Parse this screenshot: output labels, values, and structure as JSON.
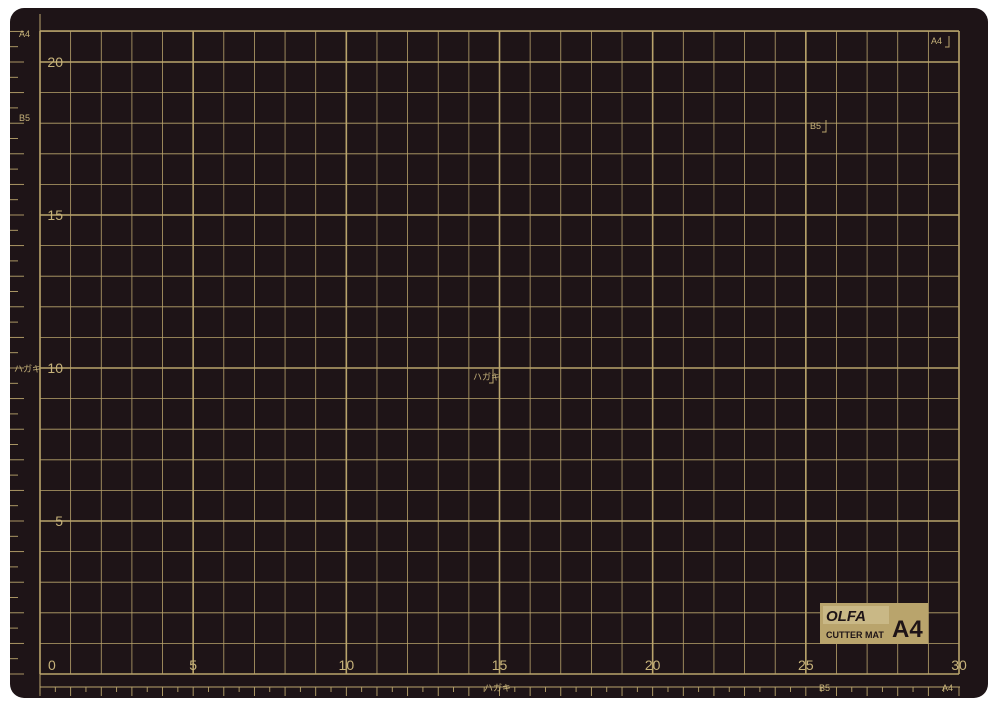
{
  "mat": {
    "background_color": "#1e1417",
    "line_color": "#b9a46c",
    "text_color": "#c6b27a",
    "x_labels": [
      "0",
      "5",
      "10",
      "15",
      "20",
      "25",
      "30"
    ],
    "y_labels": [
      "5",
      "10",
      "15",
      "20"
    ],
    "marks": {
      "a4_top_left": "A4",
      "a4_top_right": "A4",
      "a4_bottom_right": "A4",
      "b5_left": "B5",
      "b5_inner": "B5",
      "b5_bottom": "B5",
      "postcard_left": "ハガキ",
      "postcard_inner": "ハガキ",
      "postcard_bottom": "ハガキ"
    },
    "logo": {
      "brand": "OLFA",
      "product": "CUTTER MAT",
      "size": "A4"
    }
  }
}
